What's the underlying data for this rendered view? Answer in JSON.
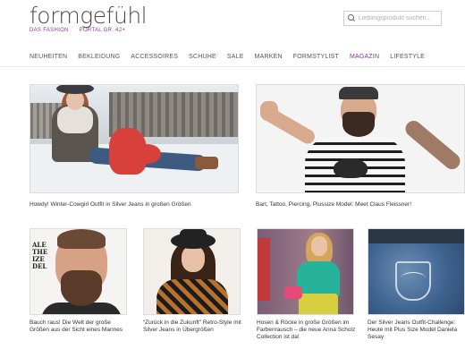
{
  "brand": {
    "name": "formgefühl",
    "tagline_left": "DAS FASHION",
    "tagline_right": "PORTAL GR. 42+"
  },
  "search": {
    "placeholder": "Lieblingsprodukt suchen..."
  },
  "nav": {
    "items": [
      {
        "label": "NEUHEITEN",
        "active": false
      },
      {
        "label": "BEKLEIDUNG",
        "active": false
      },
      {
        "label": "ACCESSOIRES",
        "active": false
      },
      {
        "label": "SCHUHE",
        "active": false
      },
      {
        "label": "SALE",
        "active": false
      },
      {
        "label": "MARKEN",
        "active": false
      },
      {
        "label": "FORMSTYLIST",
        "active": false
      },
      {
        "label": "MAGAZIN",
        "active": true
      },
      {
        "label": "LIFESTYLE",
        "active": false
      }
    ]
  },
  "colors": {
    "accent": "#7a3e86",
    "text": "#333333"
  },
  "articles": {
    "featured": [
      {
        "caption": "Howdy! Winter-Cowgirl Outfit in Silver Jeans in großen Größen"
      },
      {
        "caption": "Bart, Tattoo, Piercing, Plussize Model: Meet Claus Fleissner!"
      }
    ],
    "small": [
      {
        "caption": "Bauch raus! Die Welt der große Größen aus der Sicht eines Mannes",
        "image_text": "ALE THE IZE DEL"
      },
      {
        "caption": "“Zurück in die Zukunft” Retro-Style mit Silver Jeans in Übergrößen"
      },
      {
        "caption": "Hosen & Röcke in große Größen im Farbenrausch – die neue Anna Scholz Collection ist da!"
      },
      {
        "caption": "Der Silver Jeans Outfit-Challenge: Heute mit Plus Size Model Daniela Sesay"
      }
    ]
  }
}
